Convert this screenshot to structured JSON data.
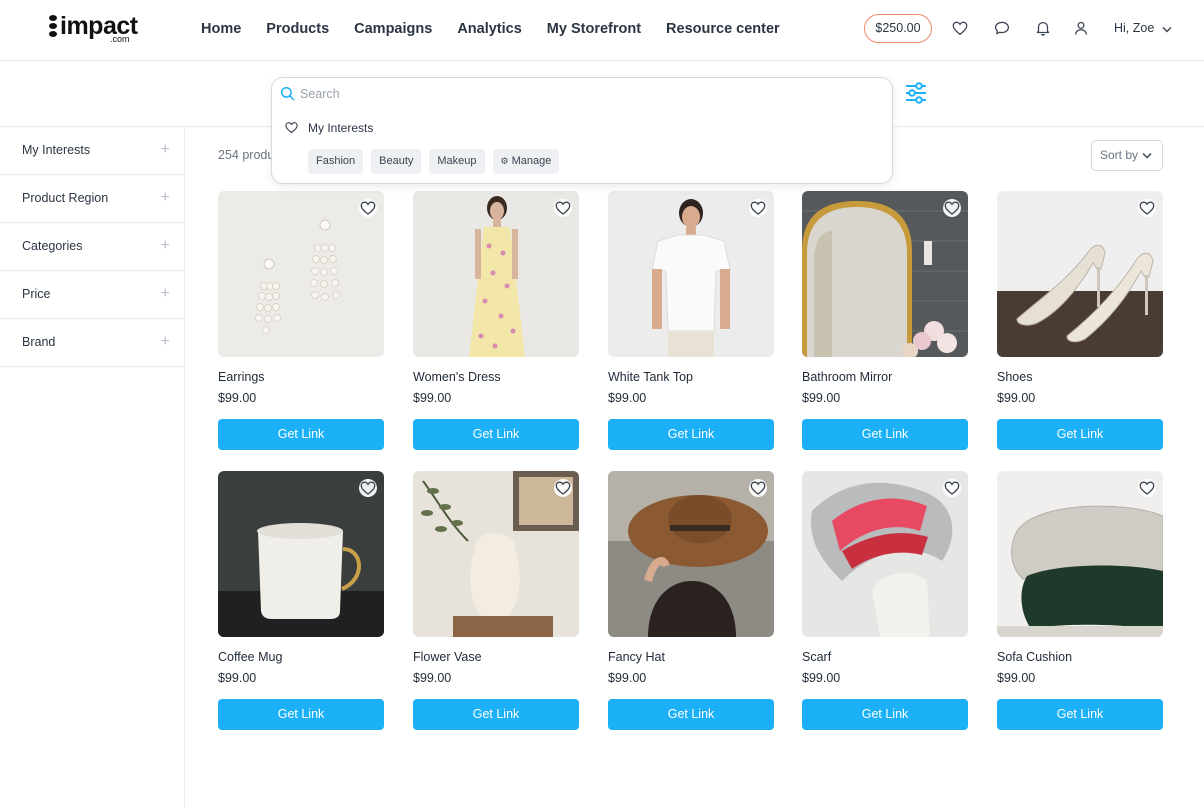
{
  "brand": {
    "logo_text": "impact",
    "logo_sub": ".com"
  },
  "nav": [
    "Home",
    "Products",
    "Campaigns",
    "Analytics",
    "My Storefront",
    "Resource center"
  ],
  "header": {
    "balance": "$250.00",
    "greeting": "Hi, Zoe"
  },
  "search": {
    "placeholder": "Search",
    "interests_label": "My Interests",
    "chips": [
      "Fashion",
      "Beauty",
      "Makeup",
      "Manage"
    ]
  },
  "sidebar": {
    "items": [
      "My Interests",
      "Product Region",
      "Categories",
      "Price",
      "Brand"
    ]
  },
  "main": {
    "count_text": "254 products",
    "sort_label": "Sort by",
    "get_link_label": "Get Link"
  },
  "products": [
    {
      "name": "Earrings",
      "price": "$99.00"
    },
    {
      "name": "Women's Dress",
      "price": "$99.00"
    },
    {
      "name": "White Tank Top",
      "price": "$99.00"
    },
    {
      "name": "Bathroom Mirror",
      "price": "$99.00"
    },
    {
      "name": "Shoes",
      "price": "$99.00"
    },
    {
      "name": "Coffee Mug",
      "price": "$99.00"
    },
    {
      "name": "Flower Vase",
      "price": "$99.00"
    },
    {
      "name": "Fancy Hat",
      "price": "$99.00"
    },
    {
      "name": "Scarf",
      "price": "$99.00"
    },
    {
      "name": "Sofa Cushion",
      "price": "$99.00"
    }
  ],
  "colors": {
    "accent": "#1cb0f6",
    "balance_border": "#f08a6a"
  }
}
